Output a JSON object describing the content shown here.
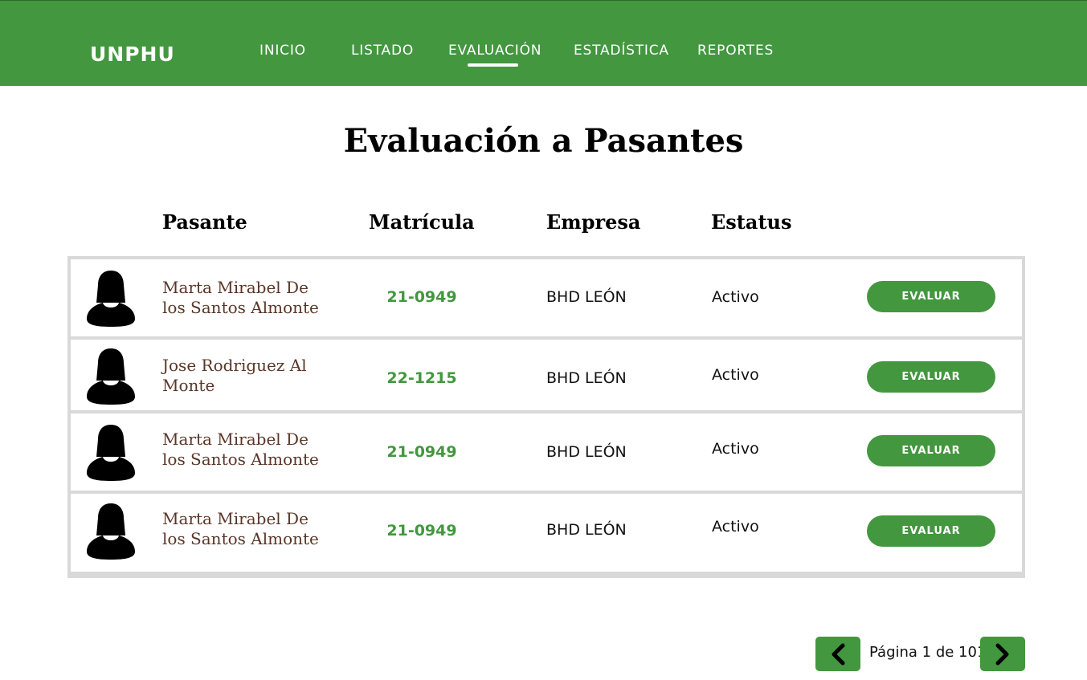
{
  "header": {
    "brand": "UNPHU",
    "nav": [
      {
        "label": "INICIO"
      },
      {
        "label": "LISTADO"
      },
      {
        "label": "EVALUACIÓN",
        "active": true
      },
      {
        "label": "ESTADÍSTICA"
      },
      {
        "label": "REPORTES"
      }
    ]
  },
  "main": {
    "title": "Evaluación a Pasantes",
    "columns": [
      "Pasante",
      "Matrícula",
      "Empresa",
      "Estatus"
    ],
    "rows": [
      {
        "name_line1": "Marta  Mirabel De",
        "name_line2": "los Santos Almonte",
        "matricula": "21-0949",
        "empresa": "BHD LEÓN",
        "estatus": "Activo",
        "action": "EVALUAR"
      },
      {
        "name_line1": "Jose Rodriguez Al",
        "name_line2": "Monte",
        "matricula": "22-1215",
        "empresa": "BHD LEÓN",
        "estatus": "Activo",
        "action": "EVALUAR"
      },
      {
        "name_line1": "Marta  Mirabel De",
        "name_line2": "los Santos Almonte",
        "matricula": "21-0949",
        "empresa": "BHD LEÓN",
        "estatus": "Activo",
        "action": "EVALUAR"
      },
      {
        "name_line1": "Marta  Mirabel De",
        "name_line2": "los Santos Almonte",
        "matricula": "21-0949",
        "empresa": "BHD LEÓN",
        "estatus": "Activo",
        "action": "EVALUAR"
      }
    ]
  },
  "pagination": {
    "text": "Página 1 de 101",
    "prev_icon": "chevron-left-icon",
    "next_icon": "chevron-right-icon"
  },
  "colors": {
    "primary": "#43973f",
    "name_text": "#5a3628",
    "row_border": "#d9d9d9"
  }
}
